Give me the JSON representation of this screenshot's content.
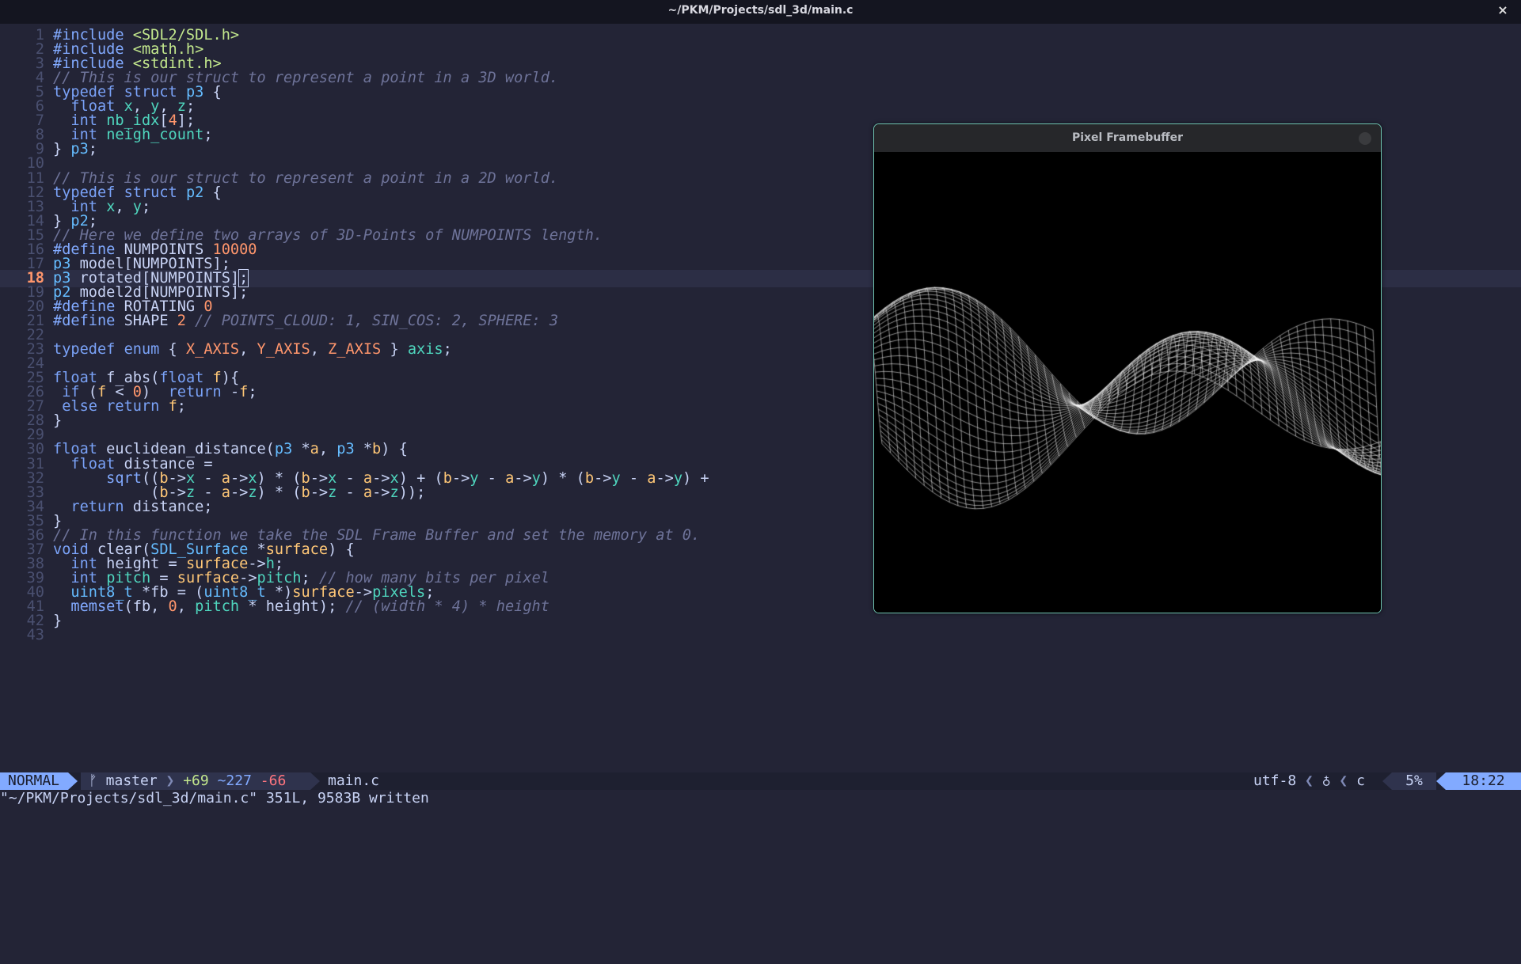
{
  "window": {
    "title": "~/PKM/Projects/sdl_3d/main.c",
    "close_glyph": "×"
  },
  "editor": {
    "lines": [
      {
        "n": "1",
        "t": "#include <SDL2/SDL.h>"
      },
      {
        "n": "2",
        "t": "#include <math.h>"
      },
      {
        "n": "3",
        "t": "#include <stdint.h>"
      },
      {
        "n": "4",
        "t": "// This is our struct to represent a point in a 3D world."
      },
      {
        "n": "5",
        "t": "typedef struct p3 {"
      },
      {
        "n": "6",
        "t": "  float x, y, z;"
      },
      {
        "n": "7",
        "t": "  int nb_idx[4];"
      },
      {
        "n": "8",
        "t": "  int neigh_count;"
      },
      {
        "n": "9",
        "t": "} p3;"
      },
      {
        "n": "10",
        "t": ""
      },
      {
        "n": "11",
        "t": "// This is our struct to represent a point in a 2D world."
      },
      {
        "n": "12",
        "t": "typedef struct p2 {"
      },
      {
        "n": "13",
        "t": "  int x, y;"
      },
      {
        "n": "14",
        "t": "} p2;"
      },
      {
        "n": "15",
        "t": "// Here we define two arrays of 3D-Points of NUMPOINTS length."
      },
      {
        "n": "16",
        "t": "#define NUMPOINTS 10000"
      },
      {
        "n": "17",
        "t": "p3 model[NUMPOINTS];"
      },
      {
        "n": "18",
        "t": "p3 rotated[NUMPOINTS];"
      },
      {
        "n": "19",
        "t": "p2 model2d[NUMPOINTS];"
      },
      {
        "n": "20",
        "t": "#define ROTATING 0"
      },
      {
        "n": "21",
        "t": "#define SHAPE 2 // POINTS_CLOUD: 1, SIN_COS: 2, SPHERE: 3"
      },
      {
        "n": "22",
        "t": ""
      },
      {
        "n": "23",
        "t": "typedef enum { X_AXIS, Y_AXIS, Z_AXIS } axis;"
      },
      {
        "n": "24",
        "t": ""
      },
      {
        "n": "25",
        "t": "float f_abs(float f){"
      },
      {
        "n": "26",
        "t": " if (f < 0)  return -f;"
      },
      {
        "n": "27",
        "t": " else return f;"
      },
      {
        "n": "28",
        "t": "}"
      },
      {
        "n": "29",
        "t": ""
      },
      {
        "n": "30",
        "t": "float euclidean_distance(p3 *a, p3 *b) {"
      },
      {
        "n": "31",
        "t": "  float distance ="
      },
      {
        "n": "32",
        "t": "      sqrt((b->x - a->x) * (b->x - a->x) + (b->y - a->y) * (b->y - a->y) +"
      },
      {
        "n": "33",
        "t": "           (b->z - a->z) * (b->z - a->z));"
      },
      {
        "n": "34",
        "t": "  return distance;"
      },
      {
        "n": "35",
        "t": "}"
      },
      {
        "n": "36",
        "t": "// In this function we take the SDL Frame Buffer and set the memory at 0."
      },
      {
        "n": "37",
        "t": "void clear(SDL_Surface *surface) {"
      },
      {
        "n": "38",
        "t": "  int height = surface->h;"
      },
      {
        "n": "39",
        "t": "  int pitch = surface->pitch; // how many bits per pixel"
      },
      {
        "n": "40",
        "t": "  uint8_t *fb = (uint8_t *)surface->pixels;"
      },
      {
        "n": "41",
        "t": "  memset(fb, 0, pitch * height); // (width * 4) * height"
      },
      {
        "n": "42",
        "t": "}"
      },
      {
        "n": "43",
        "t": ""
      }
    ]
  },
  "framebuffer": {
    "title": "Pixel Framebuffer"
  },
  "statusbar": {
    "mode": "NORMAL",
    "branch_icon": "branch-icon",
    "branch": "master",
    "added": "+69",
    "changed": "~227",
    "removed": "-66",
    "filename": "main.c",
    "encoding": "utf-8",
    "filetype_icon": "c-file-icon",
    "filetype": "c",
    "percent": "5%",
    "position": "18:22"
  },
  "cmdline": {
    "message": "\"~/PKM/Projects/sdl_3d/main.c\" 351L, 9583B written"
  },
  "colors": {
    "background": "#232436",
    "accent": "#82aaff",
    "window_border": "#6fc4b1"
  }
}
